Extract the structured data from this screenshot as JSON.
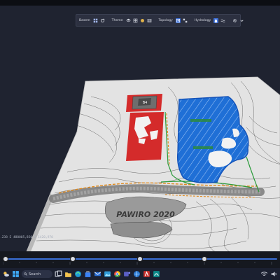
{
  "toolbar": {
    "basemap_label": "Basem",
    "theme_label": "Theme",
    "topology_label": "Topology",
    "hydrology_label": "Hydrology"
  },
  "map": {
    "building_label": "B4",
    "terrain_text": "PAWIRO 2020"
  },
  "status": {
    "coords": ".238  E 480005,850  Z 1420,970"
  },
  "taskbar": {
    "search_placeholder": "Search"
  },
  "colors": {
    "background": "#1f2330",
    "toolbar": "#2c3040",
    "terrain": "#e3e3e3",
    "restricted_zone": "#d42b2b",
    "water_zone": "#1f6fd6",
    "timeline_accent": "#3a6fd8"
  }
}
